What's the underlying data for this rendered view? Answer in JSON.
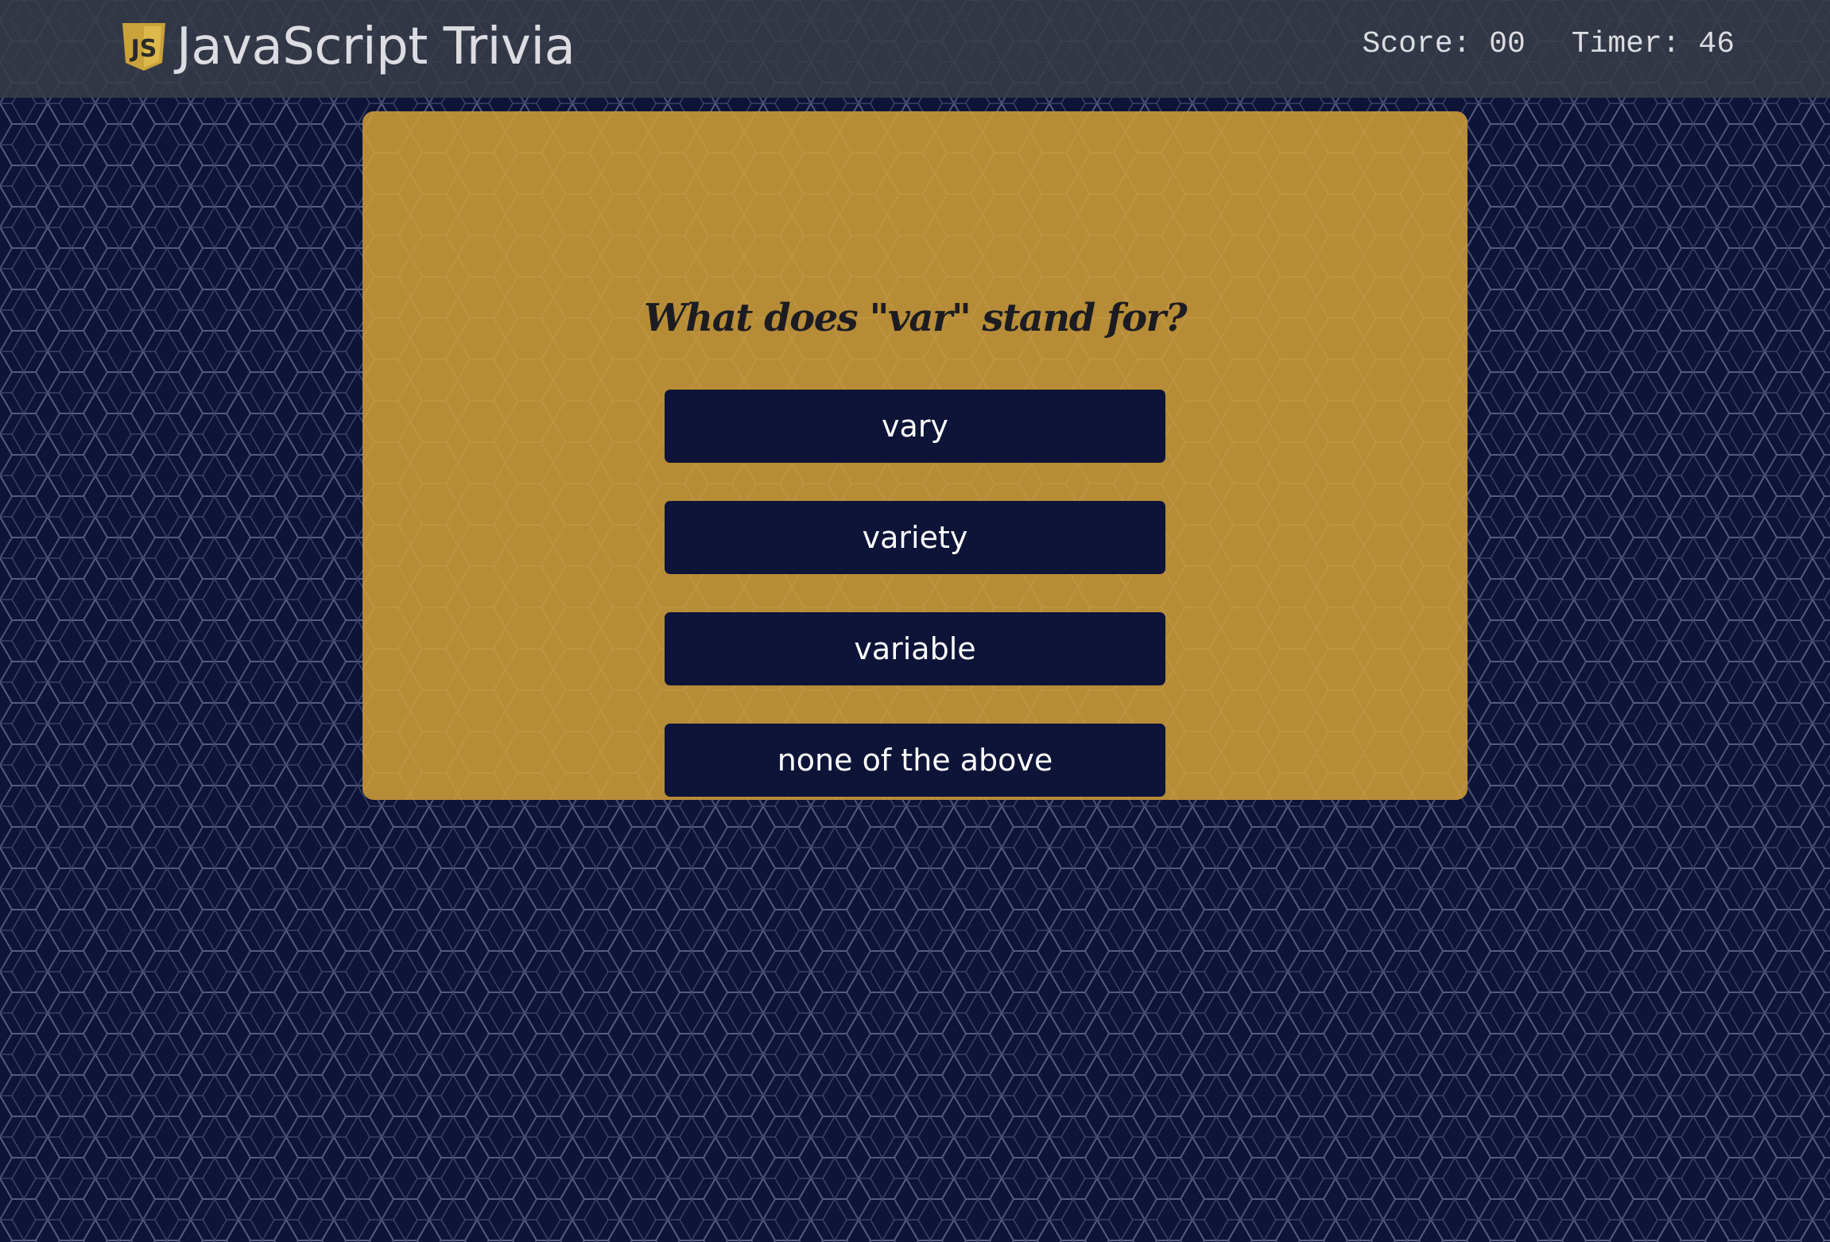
{
  "header": {
    "app_title": "JavaScript Trivia",
    "logo_icon": "js-shield-icon",
    "score_label": "Score: 00",
    "timer_label": "Timer: 46"
  },
  "quiz": {
    "question": "What does \"var\" stand for?",
    "answers": [
      "vary",
      "variety",
      "variable",
      "none of the above"
    ]
  },
  "colors": {
    "page_background": "#0d1438",
    "header_background": "#383c48",
    "card_background": "#b78c37",
    "button_background": "#0d1438",
    "button_text": "#ffffff",
    "logo_gold": "#c9a23a"
  }
}
